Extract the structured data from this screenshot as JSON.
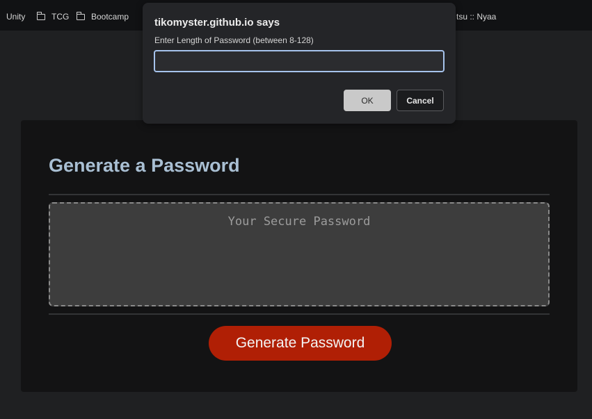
{
  "bookmarks": {
    "items": [
      {
        "label": "Unity",
        "icon": "none"
      },
      {
        "label": "TCG",
        "icon": "folder-icon"
      },
      {
        "label": "Bootcamp",
        "icon": "folder-icon"
      },
      {
        "label": "tsu :: Nyaa",
        "icon": "none"
      }
    ]
  },
  "card": {
    "title": "Generate a Password",
    "password_placeholder": "Your Secure Password",
    "generate_button": "Generate Password"
  },
  "dialog": {
    "title": "tikomyster.github.io says",
    "message": "Enter Length of Password (between 8-128)",
    "input_value": "",
    "ok_label": "OK",
    "cancel_label": "Cancel"
  },
  "colors": {
    "accent_button": "#b01f05",
    "title_color": "#a9bfd3",
    "input_focus": "#a6c3ec"
  }
}
